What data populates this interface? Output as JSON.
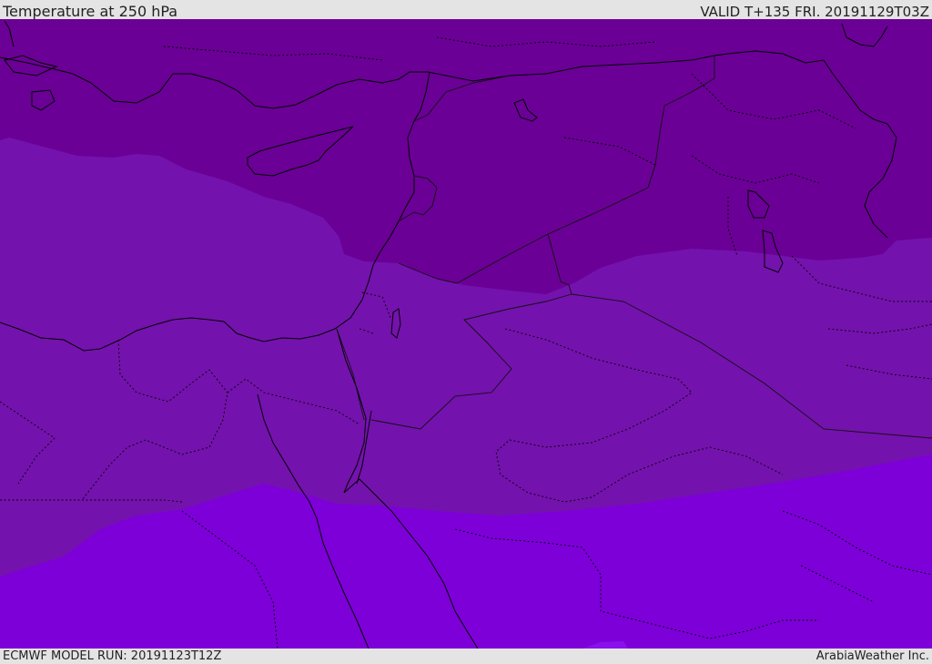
{
  "header": {
    "title": "Temperature at 250 hPa",
    "valid": "VALID T+135 FRI. 20191129T03Z"
  },
  "footer": {
    "model_run": "ECMWF MODEL RUN: 20191123T12Z",
    "credit": "ArabiaWeather Inc."
  },
  "map": {
    "variable": "temperature-250hPa",
    "colors": {
      "band_cold": "#6a0095",
      "band_mid": "#7412ad",
      "band_warm": "#7d00d8",
      "band_warmest": "#8a10ee",
      "lines": "#000000"
    }
  }
}
